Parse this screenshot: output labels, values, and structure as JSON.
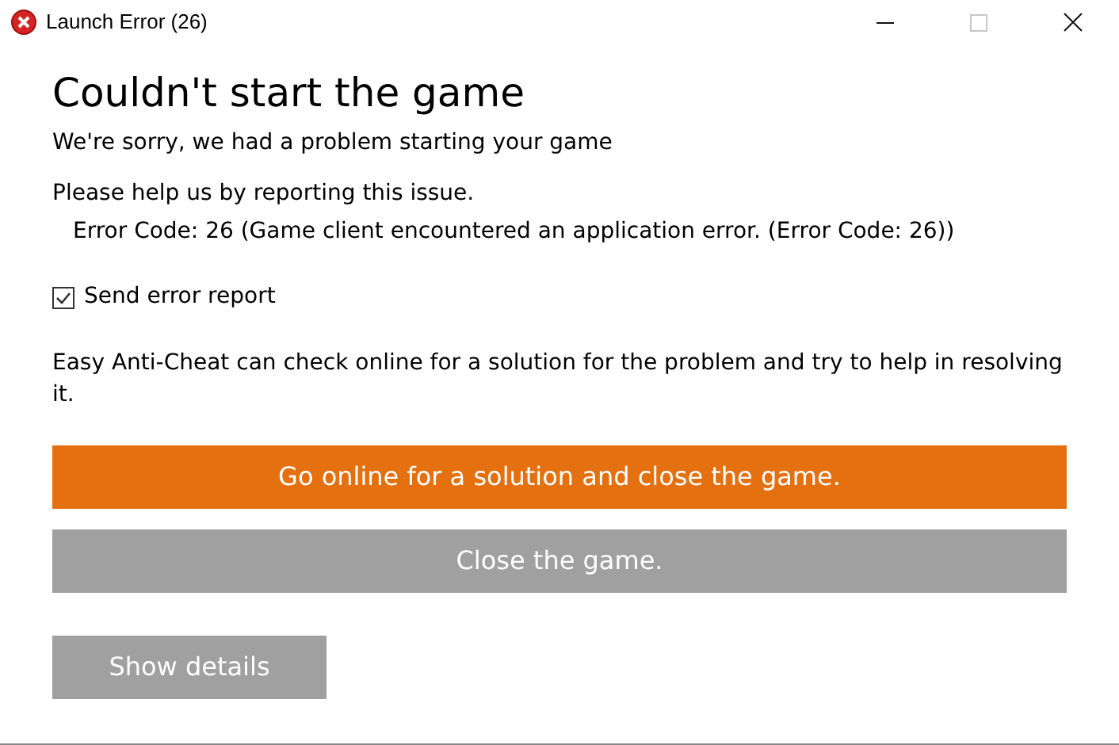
{
  "window": {
    "title": "Launch Error (26)",
    "controls": [
      {
        "kind": "minimize",
        "disabled": false
      },
      {
        "kind": "maximize",
        "disabled": true
      },
      {
        "kind": "close",
        "disabled": false
      }
    ]
  },
  "heading": "Couldn't start the game",
  "subheading": "We're sorry, we had a problem starting your game",
  "report_prompt": "Please help us by reporting this issue.",
  "error_code": "Error Code: 26 (Game client encountered an application error. (Error Code: 26))",
  "send_report": {
    "label": "Send error report",
    "checked": true
  },
  "info": "Easy Anti-Cheat can check online for a solution for the problem and try to help in resolving it.",
  "buttons": [
    {
      "label": "Go online for a solution and close the game.",
      "kind": "primary"
    },
    {
      "label": "Close the game.",
      "kind": "secondary"
    }
  ],
  "details_button": "Show details"
}
